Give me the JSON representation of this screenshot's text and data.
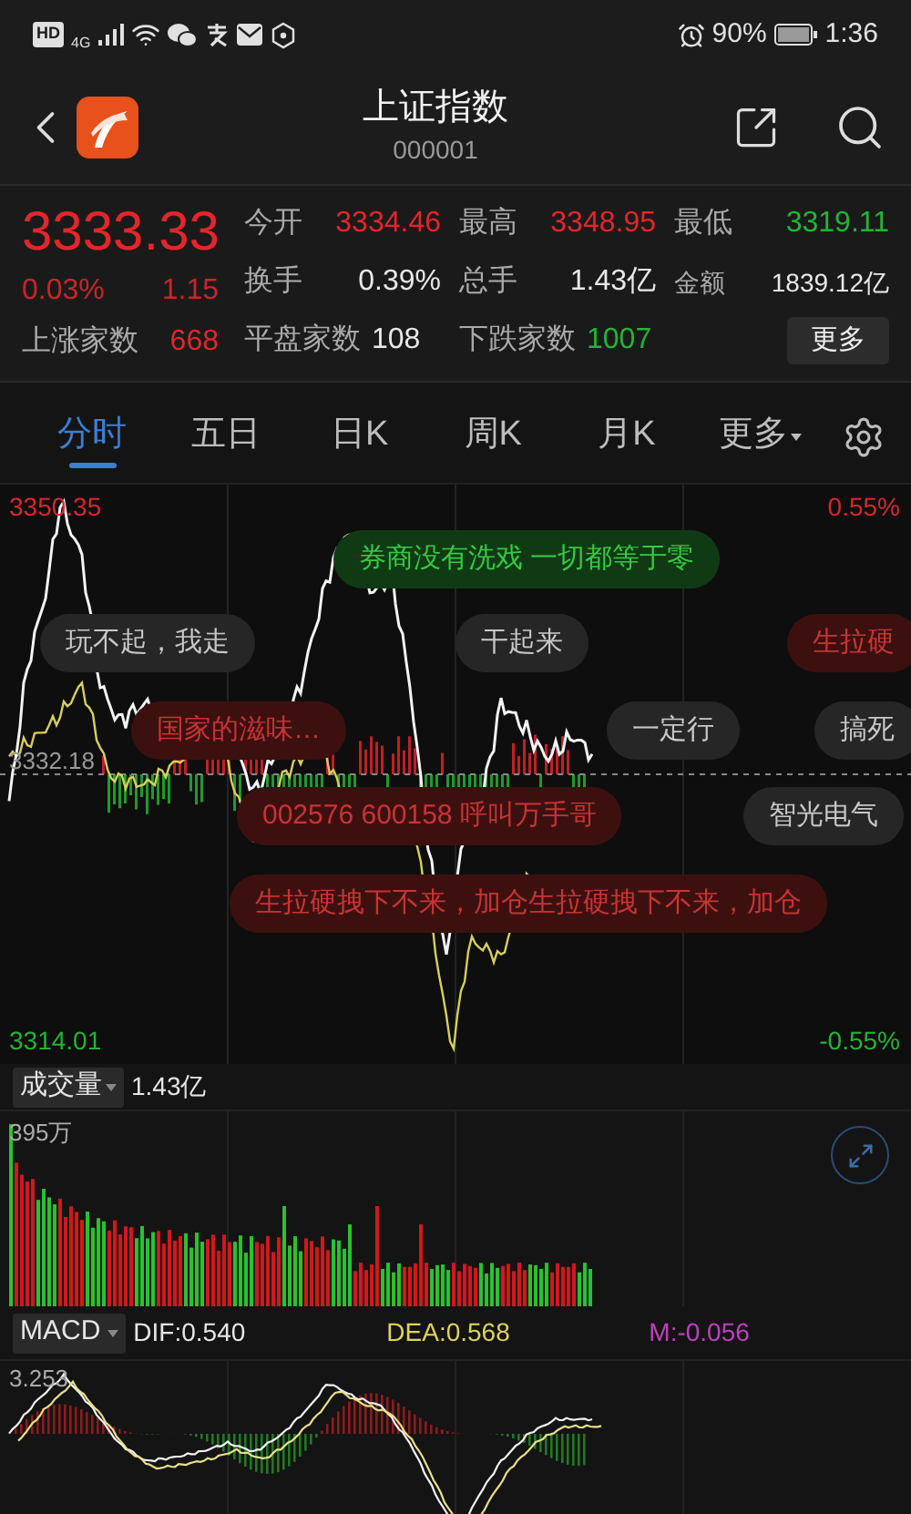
{
  "status_bar": {
    "network": [
      "HD",
      "4G"
    ],
    "battery": "90%",
    "time": "1:36"
  },
  "header": {
    "title": "上证指数",
    "code": "000001"
  },
  "quote": {
    "price": "3333.33",
    "change_pct": "0.03%",
    "change": "1.15",
    "stats": [
      {
        "label": "今开",
        "value": "3334.46",
        "color": "#e3262b"
      },
      {
        "label": "最高",
        "value": "3348.95",
        "color": "#e3262b"
      },
      {
        "label": "最低",
        "value": "3319.11",
        "color": "#22b534"
      },
      {
        "label": "换手",
        "value": "0.39%",
        "color": "#e8e8e8"
      },
      {
        "label": "总手",
        "value": "1.43亿",
        "color": "#e8e8e8"
      },
      {
        "label": "金额",
        "value": "1839.12亿",
        "color": "#e8e8e8"
      }
    ],
    "breadth": [
      {
        "label": "上涨家数",
        "value": "668",
        "color": "#e3262b"
      },
      {
        "label": "平盘家数",
        "value": "108",
        "color": "#e8e8e8"
      },
      {
        "label": "下跌家数",
        "value": "1007",
        "color": "#22b534"
      }
    ],
    "more_button": "更多"
  },
  "tabs": [
    {
      "label": "分时",
      "selected": true,
      "kind": "plain"
    },
    {
      "label": "五日",
      "selected": false,
      "kind": "plain"
    },
    {
      "label": "日K",
      "selected": false,
      "kind": "plain"
    },
    {
      "label": "周K",
      "selected": false,
      "kind": "plain"
    },
    {
      "label": "月K",
      "selected": false,
      "kind": "plain"
    },
    {
      "label": "更多",
      "selected": false,
      "kind": "dropdown"
    }
  ],
  "intraday": {
    "high": "3350.35",
    "high_pct": "0.55%",
    "prev_close": "3332.18",
    "low": "3314.01",
    "low_pct": "-0.55%",
    "comments": [
      {
        "text": "券商没有洗戏 一切都等于零",
        "color": "#103a14"
      },
      {
        "text": "玩不起，我走",
        "color": "#262626"
      },
      {
        "text": "干起来",
        "color": "#262626"
      },
      {
        "text": "生拉硬",
        "color": "#3d1010"
      },
      {
        "text": "国家的滋味…",
        "color": "#3d1010"
      },
      {
        "text": "一定行",
        "color": "#262626"
      },
      {
        "text": "搞死",
        "color": "#262626"
      },
      {
        "text": "002576 600158 呼叫万手哥",
        "color": "#3d1010"
      },
      {
        "text": "智光电气",
        "color": "#262626"
      },
      {
        "text": "生拉硬拽下不来，加仓生拉硬拽下不来，加仓",
        "color": "#3d1010"
      }
    ]
  },
  "volume": {
    "indicator": "成交量",
    "total": "1.43亿",
    "max": "395万"
  },
  "macd": {
    "indicator": "MACD",
    "dif": "DIF:0.540",
    "dea": "DEA:0.568",
    "m": "M:-0.056",
    "max": "3.253"
  }
}
